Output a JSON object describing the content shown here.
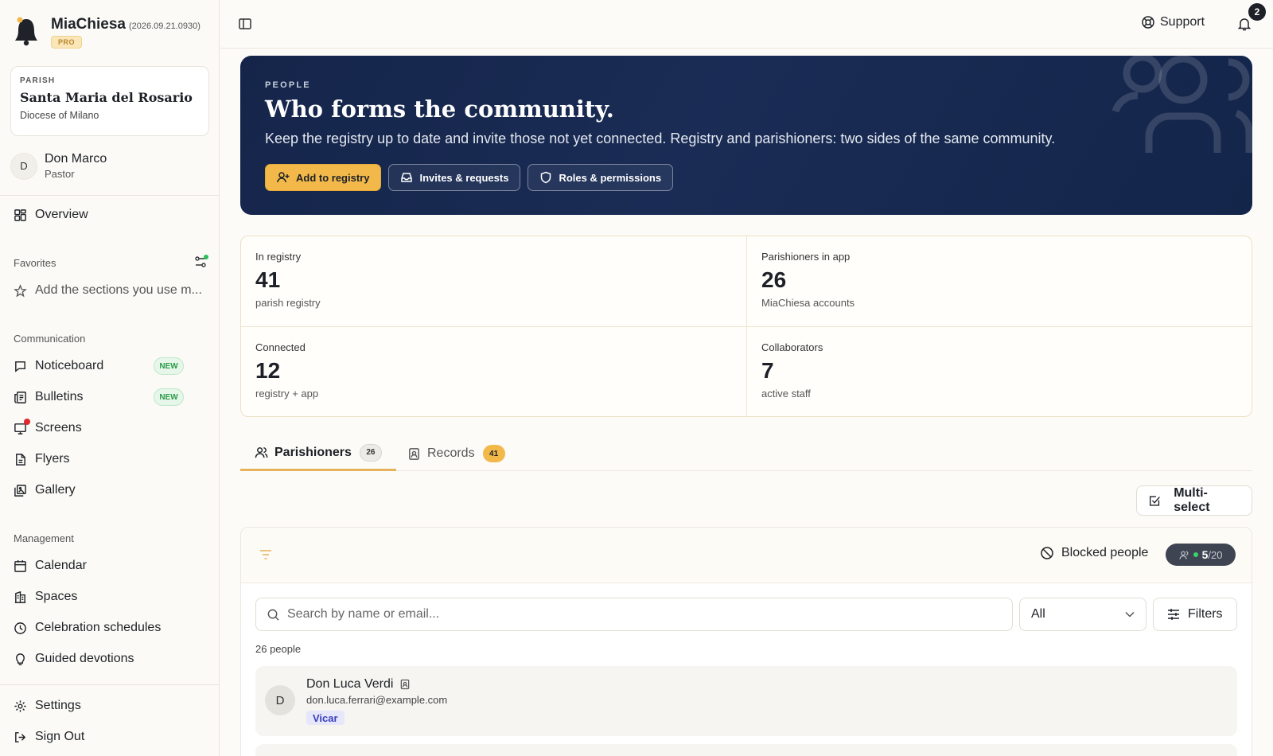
{
  "app": {
    "name": "MiaChiesa",
    "version": "(2026.09.21.0930)",
    "plan": "PRO"
  },
  "parish": {
    "label": "PARISH",
    "name": "Santa Maria del Rosario",
    "diocese": "Diocese of Milano"
  },
  "user": {
    "initial": "D",
    "name": "Don Marco",
    "role": "Pastor"
  },
  "sidebar": {
    "overview": "Overview",
    "favorites_title": "Favorites",
    "favorites_hint": "Add the sections you use m...",
    "communication_title": "Communication",
    "communication": [
      {
        "label": "Noticeboard",
        "badge": "NEW"
      },
      {
        "label": "Bulletins",
        "badge": "NEW"
      },
      {
        "label": "Screens"
      },
      {
        "label": "Flyers"
      },
      {
        "label": "Gallery"
      }
    ],
    "management_title": "Management",
    "management": [
      {
        "label": "Calendar"
      },
      {
        "label": "Spaces"
      },
      {
        "label": "Celebration schedules"
      },
      {
        "label": "Guided devotions"
      }
    ],
    "settings": "Settings",
    "sign_out": "Sign Out"
  },
  "topbar": {
    "support": "Support",
    "notifications": "2"
  },
  "hero": {
    "overline": "PEOPLE",
    "title": "Who forms the community.",
    "subtitle": "Keep the registry up to date and invite those not yet connected. Registry and parishioners: two sides of the same community.",
    "buttons": {
      "add": "Add to registry",
      "invites": "Invites & requests",
      "roles": "Roles & permissions"
    }
  },
  "stats": [
    {
      "label": "In registry",
      "value": "41",
      "sub": "parish registry"
    },
    {
      "label": "Parishioners in app",
      "value": "26",
      "sub": "MiaChiesa accounts"
    },
    {
      "label": "Connected",
      "value": "12",
      "sub": "registry + app"
    },
    {
      "label": "Collaborators",
      "value": "7",
      "sub": "active staff"
    }
  ],
  "tabs": [
    {
      "label": "Parishioners",
      "count": "26"
    },
    {
      "label": "Records",
      "count": "41"
    }
  ],
  "toolbar": {
    "multiselect": "Multi-select",
    "blocked": "Blocked people",
    "quota_used": "5",
    "quota_total": "/20"
  },
  "search": {
    "placeholder": "Search by name or email...",
    "filter_value": "All",
    "filters_label": "Filters"
  },
  "list": {
    "count": "26 people",
    "people": [
      {
        "initial": "D",
        "name": "Don Luca Verdi",
        "email": "don.luca.ferrari@example.com",
        "role": "Vicar"
      }
    ]
  },
  "colors": {
    "accent": "#f2b94a",
    "hero_bg": "#15254a",
    "new_badge": "#2d9a4a",
    "role_badge": "#3b3fb8"
  }
}
